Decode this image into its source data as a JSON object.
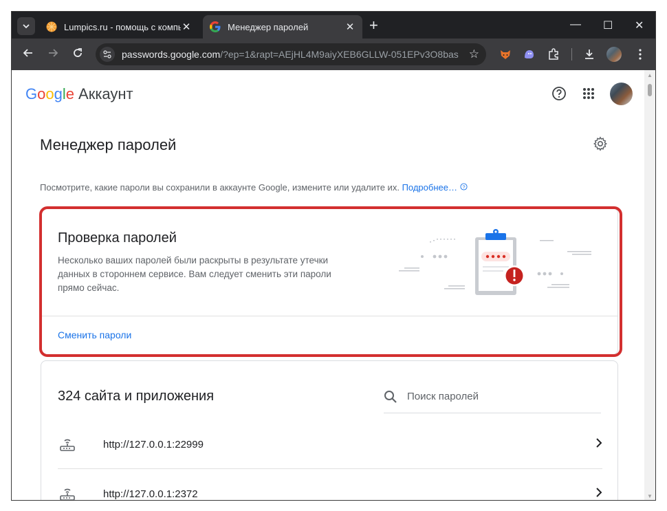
{
  "browser": {
    "tabs": [
      {
        "title": "Lumpics.ru - помощь с компьютером",
        "active": false
      },
      {
        "title": "Менеджер паролей",
        "active": true
      }
    ],
    "new_tab_symbol": "+",
    "window_controls": {
      "minimize": "—",
      "maximize": "☐",
      "close": "✕"
    },
    "url_host": "passwords.google.com",
    "url_rest": "/?ep=1&rapt=AEjHL4M9aiyXEB6GLLW-051EPv3O8bas..."
  },
  "header": {
    "logo_letters": [
      "G",
      "o",
      "o",
      "g",
      "l",
      "e"
    ],
    "logo_colors": [
      "#4285F4",
      "#EA4335",
      "#FBBC05",
      "#4285F4",
      "#34A853",
      "#EA4335"
    ],
    "product": "Аккаунт"
  },
  "page": {
    "title": "Менеджер паролей",
    "description": "Посмотрите, какие пароли вы сохранили в аккаунте Google, измените или удалите их.",
    "learn_more": "Подробнее…"
  },
  "checkup": {
    "title": "Проверка паролей",
    "text": "Несколько ваших паролей были раскрыты в результате утечки данных в стороннем сервисе. Вам следует сменить эти пароли прямо сейчас.",
    "action": "Сменить пароли",
    "highlight_color": "#d32f2f"
  },
  "sites": {
    "title": "324 сайта и приложения",
    "search_placeholder": "Поиск паролей",
    "items": [
      {
        "name": "http://127.0.0.1:22999",
        "icon": "router-icon"
      },
      {
        "name": "http://127.0.0.1:2372",
        "icon": "router-icon"
      }
    ]
  }
}
